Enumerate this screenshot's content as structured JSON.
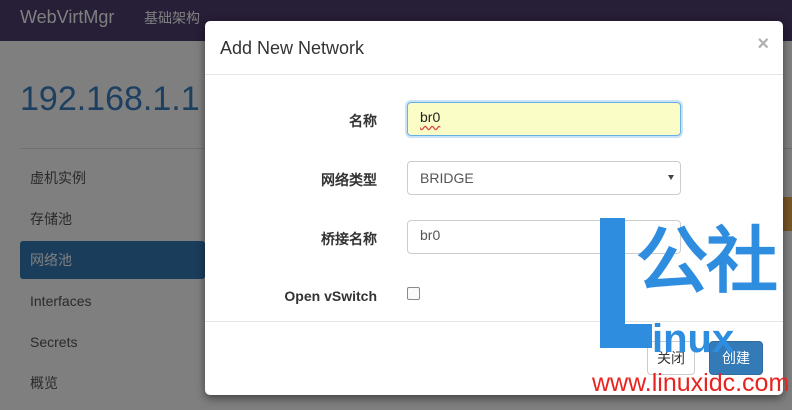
{
  "navbar": {
    "brand": "WebVirtMgr",
    "link": "基础架构"
  },
  "page": {
    "host_title": "192.168.1.1",
    "sidebar": [
      {
        "label": "虚机实例",
        "active": false
      },
      {
        "label": "存储池",
        "active": false
      },
      {
        "label": "网络池",
        "active": true
      },
      {
        "label": "Interfaces",
        "active": false
      },
      {
        "label": "Secrets",
        "active": false
      },
      {
        "label": "概览",
        "active": false
      }
    ]
  },
  "modal": {
    "title": "Add New Network",
    "close_glyph": "×",
    "fields": {
      "name_label": "名称",
      "name_value": "br0",
      "type_label": "网络类型",
      "type_value": "BRIDGE",
      "bridge_label": "桥接名称",
      "bridge_value": "br0",
      "ovs_label": "Open vSwitch",
      "ovs_checked": false
    },
    "buttons": {
      "close_label": "关闭",
      "create_label": "创建"
    }
  },
  "watermark": {
    "big_text": "公社",
    "linux_text": "inux",
    "url": "www.linuxidc.com"
  },
  "colors": {
    "navbar": "#4e3d6e",
    "primary": "#337ab7",
    "watermark_blue": "#2f8de0",
    "watermark_red": "#e8231f"
  }
}
